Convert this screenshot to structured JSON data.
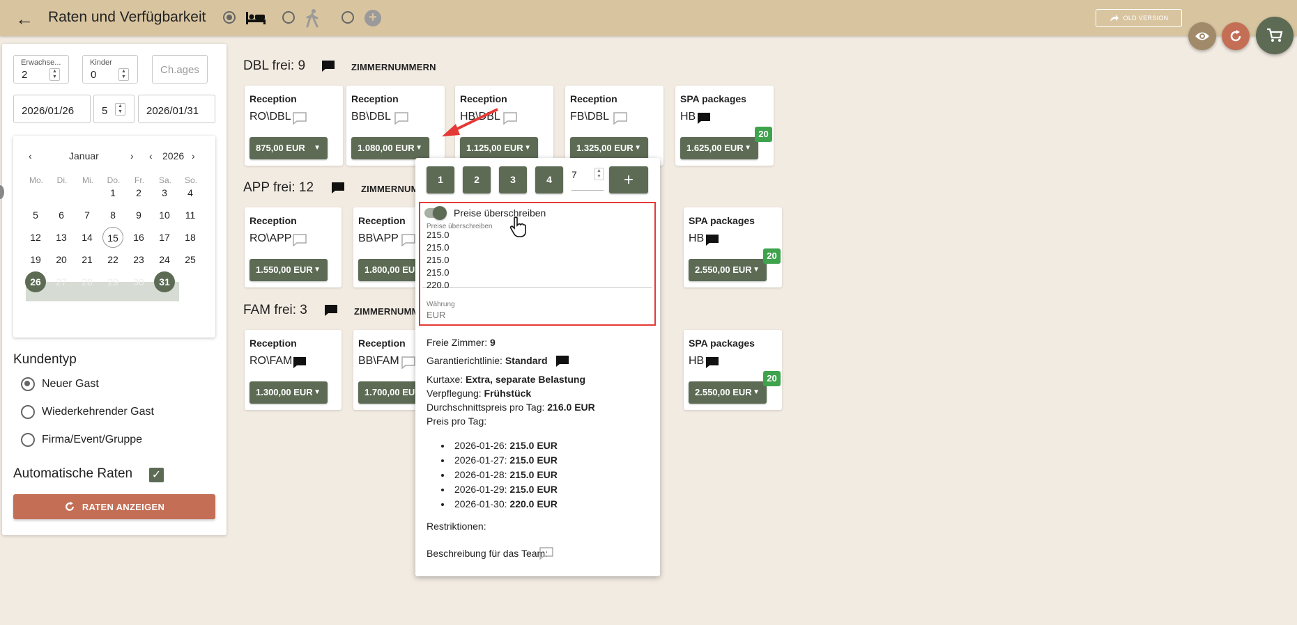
{
  "header": {
    "title": "Raten und Verfügbarkeit",
    "old_version": "OLD VERSION",
    "icons": [
      "arrow-back-icon",
      "bed-icon",
      "walking-person-icon",
      "plus-circle-icon",
      "share-icon",
      "eye-icon",
      "refresh-icon",
      "cart-icon"
    ]
  },
  "search": {
    "adults_label": "Erwachse...",
    "adults_value": "2",
    "children_label": "Kinder",
    "children_value": "0",
    "child_ages_placeholder": "Ch.ages",
    "arrival": "2026/01/26",
    "nights": "5",
    "departure": "2026/01/31"
  },
  "calendar": {
    "month": "Januar",
    "year": "2026",
    "weekdays": [
      "Mo.",
      "Di.",
      "Mi.",
      "Do.",
      "Fr.",
      "Sa.",
      "So."
    ],
    "today": "15",
    "selected_start": "26",
    "selected_end": "31"
  },
  "customer": {
    "heading": "Kundentyp",
    "options": [
      "Neuer Gast",
      "Wiederkehrender Gast",
      "Firma/Event/Gruppe"
    ],
    "selected": "Neuer Gast",
    "auto_rates": "Automatische Raten",
    "auto_rates_checked": true,
    "show_rates_button": "RATEN ANZEIGEN"
  },
  "sections": [
    {
      "title": "DBL frei: 9",
      "zimmer": "ZIMMERNUMMERN",
      "cards": [
        {
          "title": "Reception",
          "code": "RO\\DBL",
          "price": "875,00 EUR"
        },
        {
          "title": "Reception",
          "code": "BB\\DBL",
          "price": "1.080,00 EUR"
        },
        {
          "title": "Reception",
          "code": "HB\\DBL",
          "price": "1.125,00 EUR"
        },
        {
          "title": "Reception",
          "code": "FB\\DBL",
          "price": "1.325,00 EUR"
        },
        {
          "title": "SPA packages",
          "code": "HB",
          "price": "1.625,00 EUR",
          "badge": "20"
        }
      ]
    },
    {
      "title": "APP frei: 12",
      "zimmer": "ZIMMERNUMMERN",
      "cards": [
        {
          "title": "Reception",
          "code": "RO\\APP",
          "price": "1.550,00 EUR"
        },
        {
          "title": "Reception",
          "code": "BB\\APP",
          "price": "1.800,00 EUR"
        },
        {
          "title": "SPA packages",
          "code": "HB",
          "price": "2.550,00 EUR",
          "badge": "20"
        }
      ]
    },
    {
      "title": "FAM frei: 3",
      "zimmer": "ZIMMERNUMMERN",
      "cards": [
        {
          "title": "Reception",
          "code": "RO\\FAM",
          "price": "1.300,00 EUR"
        },
        {
          "title": "Reception",
          "code": "BB\\FAM",
          "price": "1.700,00 EUR"
        },
        {
          "title": "SPA packages",
          "code": "HB",
          "price": "2.550,00 EUR",
          "badge": "20"
        }
      ]
    }
  ],
  "popup": {
    "buttons": [
      "1",
      "2",
      "3",
      "4"
    ],
    "count_value": "7",
    "add": "+",
    "override_toggle": "Preise überschreiben",
    "override_label": "Preise überschreiben",
    "override_values": [
      "215.0",
      "215.0",
      "215.0",
      "215.0",
      "220.0"
    ],
    "currency_label": "Währung",
    "currency_value": "EUR",
    "free_rooms_label": "Freie Zimmer:",
    "free_rooms_value": "9",
    "guarantee_label": "Garantierichtlinie:",
    "guarantee_value": "Standard",
    "tax_label": "Kurtaxe:",
    "tax_value": "Extra, separate Belastung",
    "board_label": "Verpflegung:",
    "board_value": "Frühstück",
    "avg_label": "Durchschnittspreis pro Tag:",
    "avg_value": "216.0 EUR",
    "per_day_label": "Preis pro Tag:",
    "per_day": [
      {
        "date": "2026-01-26:",
        "price": "215.0 EUR"
      },
      {
        "date": "2026-01-27:",
        "price": "215.0 EUR"
      },
      {
        "date": "2026-01-28:",
        "price": "215.0 EUR"
      },
      {
        "date": "2026-01-29:",
        "price": "215.0 EUR"
      },
      {
        "date": "2026-01-30:",
        "price": "220.0 EUR"
      }
    ],
    "restrictions_label": "Restriktionen:",
    "team_desc_label": "Beschreibung für das Team:"
  },
  "colors": {
    "header": "#d8c5a0",
    "background": "#f2ebe2",
    "primary": "#5d6b55",
    "accent": "#c46f55",
    "badge": "#3fa34d",
    "highlight": "#e53935"
  }
}
